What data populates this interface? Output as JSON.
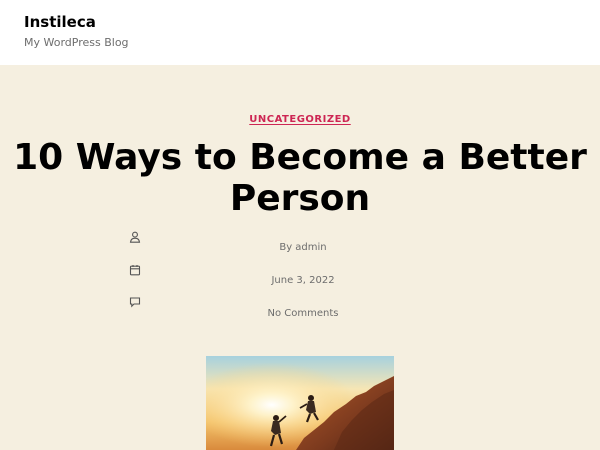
{
  "site": {
    "title": "Instileca",
    "description": "My WordPress Blog"
  },
  "post": {
    "category": "UNCATEGORIZED",
    "title": "10 Ways to Become a Better Person",
    "meta": {
      "author": "By admin",
      "date": "June 3, 2022",
      "comments": "No Comments"
    },
    "featured_image_alt": "two people climbing a rock at sunset"
  },
  "colors": {
    "accent": "#cd2653",
    "background": "#f5efe0",
    "header": "#ffffff"
  },
  "icons": [
    "user-icon",
    "calendar-icon",
    "comment-icon"
  ]
}
